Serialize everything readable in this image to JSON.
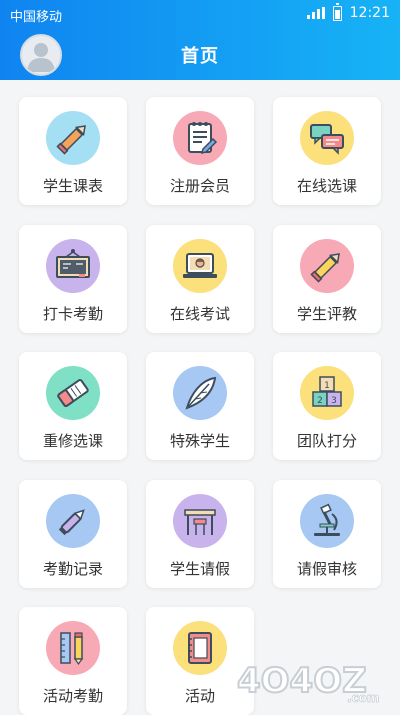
{
  "status_bar": {
    "carrier": "中国移动",
    "time": "12:21"
  },
  "header": {
    "title": "首页",
    "avatar_icon": "user-avatar-icon",
    "accent": "#0f84f0"
  },
  "menu": [
    {
      "label": "学生课表",
      "icon": "pencil-icon",
      "color": "#a5dff3"
    },
    {
      "label": "注册会员",
      "icon": "notepad-icon",
      "color": "#f7a9b5"
    },
    {
      "label": "在线选课",
      "icon": "chat-bubbles-icon",
      "color": "#fbe07c"
    },
    {
      "label": "打卡考勤",
      "icon": "blackboard-icon",
      "color": "#c8b3ec"
    },
    {
      "label": "在线考试",
      "icon": "laptop-icon",
      "color": "#fbe07c"
    },
    {
      "label": "学生评教",
      "icon": "pencil-icon",
      "color": "#f7a9b5"
    },
    {
      "label": "重修选课",
      "icon": "eraser-icon",
      "color": "#7fe0c5"
    },
    {
      "label": "特殊学生",
      "icon": "feather-icon",
      "color": "#a7c8f3"
    },
    {
      "label": "团队打分",
      "icon": "number-blocks-icon",
      "color": "#fbe07c"
    },
    {
      "label": "考勤记录",
      "icon": "pen-icon",
      "color": "#a7c8f3"
    },
    {
      "label": "学生请假",
      "icon": "desk-icon",
      "color": "#c8b3ec"
    },
    {
      "label": "请假审核",
      "icon": "microscope-icon",
      "color": "#a7c8f3"
    },
    {
      "label": "活动考勤",
      "icon": "ruler-icon",
      "color": "#f7a9b5"
    },
    {
      "label": "活动",
      "icon": "notebook-icon",
      "color": "#fbe07c"
    }
  ],
  "watermark": {
    "text": "4O4OZ.com"
  }
}
